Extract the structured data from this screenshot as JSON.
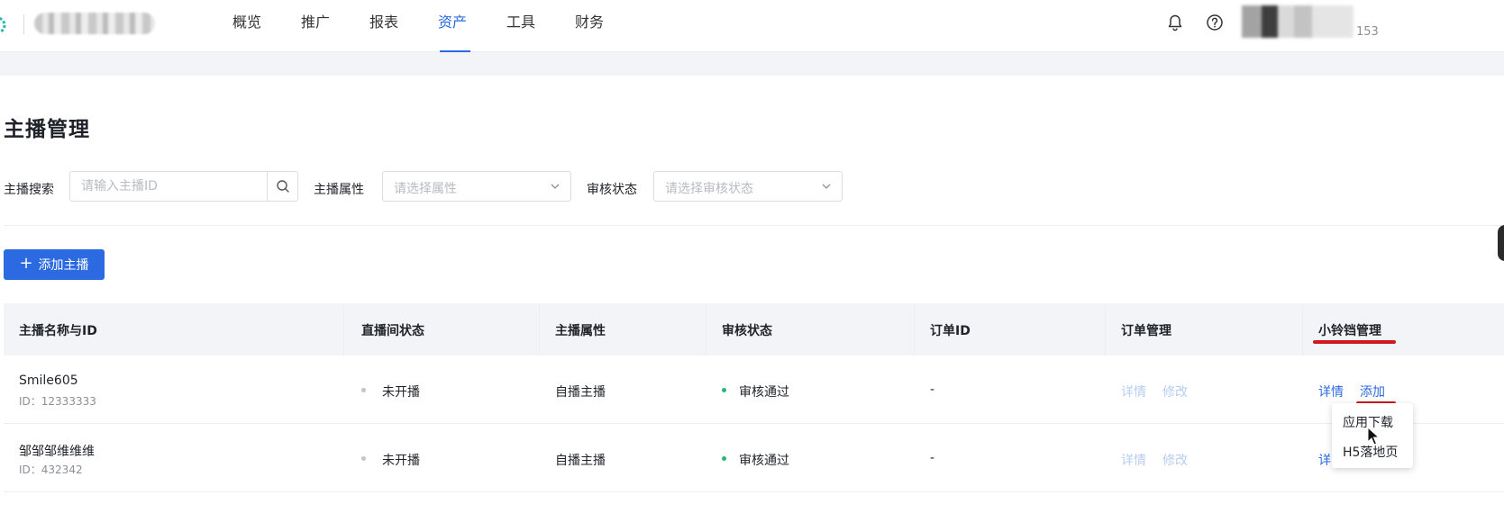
{
  "nav": {
    "items": [
      "概览",
      "推广",
      "报表",
      "资产",
      "工具",
      "财务"
    ],
    "active": "资产"
  },
  "header": {
    "user_suffix": "153"
  },
  "page": {
    "title": "主播管理"
  },
  "filters": {
    "search_label": "主播搜索",
    "search_placeholder": "请输入主播ID",
    "attr_label": "主播属性",
    "attr_placeholder": "请选择属性",
    "review_label": "审核状态",
    "review_placeholder": "请选择审核状态"
  },
  "actions": {
    "add_label": "添加主播",
    "add_icon": "plus-icon"
  },
  "table": {
    "headers": [
      "主播名称与ID",
      "直播间状态",
      "主播属性",
      "审核状态",
      "订单ID",
      "订单管理",
      "小铃铛管理"
    ],
    "rows": [
      {
        "name": "Smile605",
        "id": "ID：12333333",
        "live_status": "未开播",
        "attribute": "自播主播",
        "review_status": "审核通过",
        "order_id": "-",
        "order_detail": "详情",
        "order_edit": "修改",
        "bell_detail": "详情",
        "bell_add": "添加"
      },
      {
        "name": "邹邹邹维维维",
        "id": "ID：432342",
        "live_status": "未开播",
        "attribute": "自播主播",
        "review_status": "审核通过",
        "order_id": "-",
        "order_detail": "详情",
        "order_edit": "修改",
        "bell_detail": "详"
      }
    ]
  },
  "dropdown": {
    "items": [
      "应用下载",
      "H5落地页"
    ]
  },
  "colors": {
    "accent": "#2b6ae0",
    "status_offline": "#c0c4cc",
    "status_approved": "#2bb673",
    "annotation": "#d0181f"
  }
}
